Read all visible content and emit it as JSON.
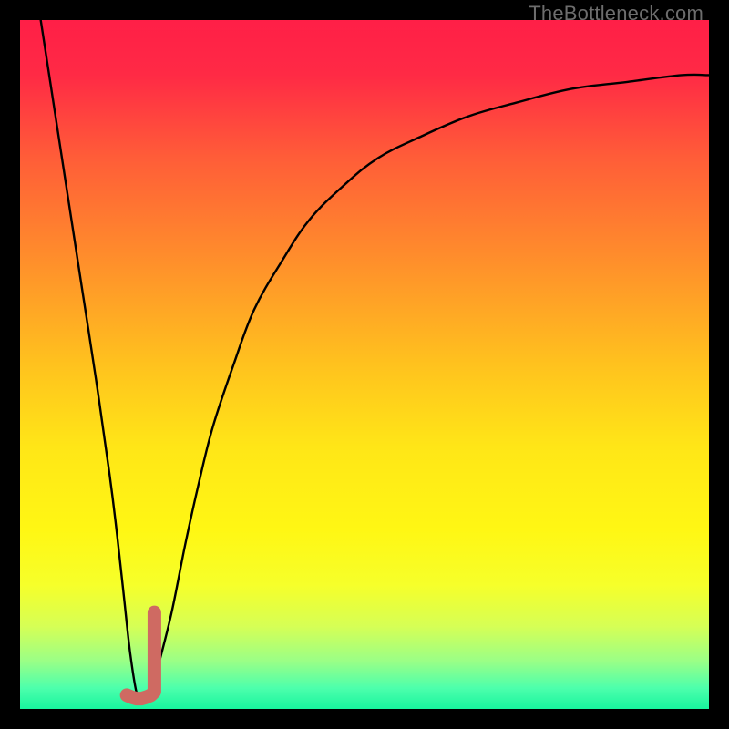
{
  "watermark": {
    "text": "TheBottleneck.com"
  },
  "colors": {
    "frame": "#000000",
    "gradient_stops": [
      {
        "offset": 0.0,
        "color": "#ff1f47"
      },
      {
        "offset": 0.08,
        "color": "#ff2a45"
      },
      {
        "offset": 0.2,
        "color": "#ff5d38"
      },
      {
        "offset": 0.35,
        "color": "#ff8f2b"
      },
      {
        "offset": 0.5,
        "color": "#ffc21e"
      },
      {
        "offset": 0.62,
        "color": "#ffe617"
      },
      {
        "offset": 0.74,
        "color": "#fff714"
      },
      {
        "offset": 0.82,
        "color": "#f6ff2a"
      },
      {
        "offset": 0.88,
        "color": "#d6ff55"
      },
      {
        "offset": 0.93,
        "color": "#9bff86"
      },
      {
        "offset": 0.97,
        "color": "#4cffac"
      },
      {
        "offset": 1.0,
        "color": "#18f59e"
      }
    ],
    "curve_stroke": "#000000",
    "marker_stroke": "#cf6a62"
  },
  "chart_data": {
    "type": "line",
    "title": "",
    "xlabel": "",
    "ylabel": "",
    "xlim": [
      0,
      100
    ],
    "ylim": [
      0,
      100
    ],
    "grid": false,
    "series": [
      {
        "name": "bottleneck-curve",
        "x": [
          3,
          5,
          7,
          9,
          11,
          13,
          14,
          15,
          16,
          17,
          18,
          19,
          20,
          22,
          24,
          26,
          28,
          31,
          34,
          38,
          42,
          47,
          52,
          58,
          65,
          72,
          80,
          88,
          96,
          100
        ],
        "y": [
          100,
          87,
          74,
          61,
          48,
          34,
          26,
          17,
          8,
          2,
          1,
          2,
          6,
          14,
          24,
          33,
          41,
          50,
          58,
          65,
          71,
          76,
          80,
          83,
          86,
          88,
          90,
          91,
          92,
          92
        ]
      }
    ],
    "marker": {
      "name": "highlight-range",
      "x": [
        15.5,
        16.2,
        16.9,
        17.6,
        18.3,
        19.0,
        19.5,
        19.5,
        19.5,
        19.5,
        19.5
      ],
      "y": [
        2.0,
        1.7,
        1.5,
        1.5,
        1.7,
        2.0,
        2.5,
        5.0,
        8.0,
        11.0,
        14.0
      ]
    }
  }
}
